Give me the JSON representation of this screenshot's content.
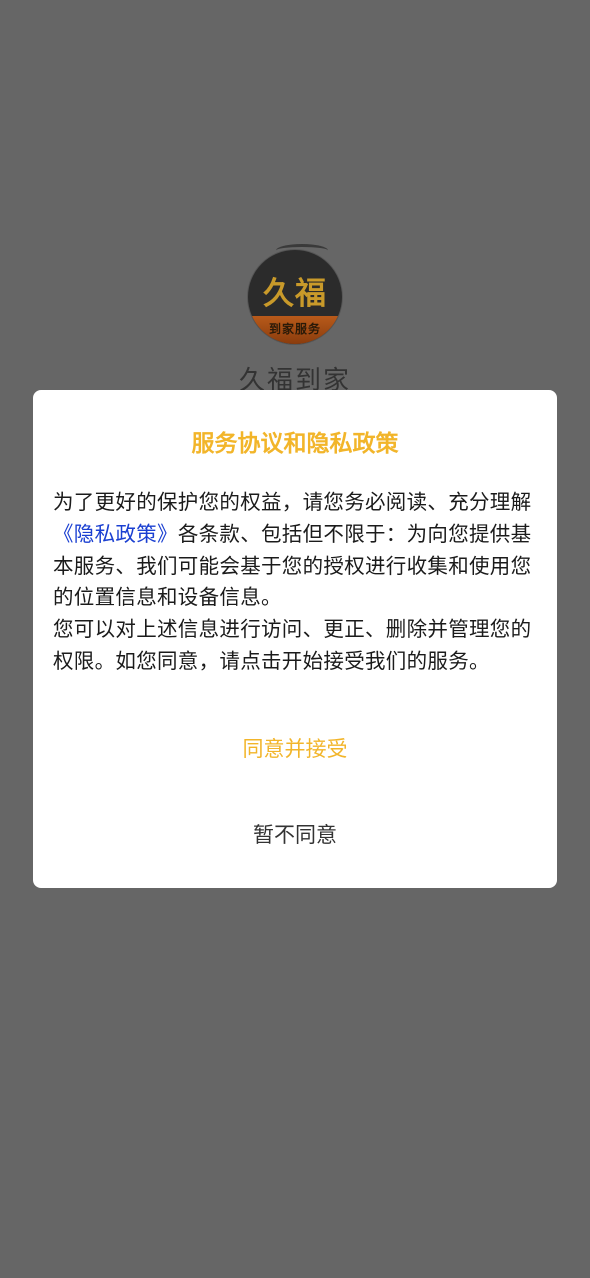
{
  "splash": {
    "logo_main": "久福",
    "logo_sub": "到家服务",
    "app_name": "久福到家"
  },
  "dialog": {
    "title": "服务协议和隐私政策",
    "para1_pre": "为了更好的保护您的权益，请您务必阅读、充分理解",
    "policy_link": "《隐私政策》",
    "para1_post": "各条款、包括但不限于：为向您提供基本服务、我们可能会基于您的授权进行收集和使用您的位置信息和设备信息。",
    "para2": "您可以对上述信息进行访问、更正、删除并管理您的权限。如您同意，请点击开始接受我们的服务。",
    "agree_label": "同意并接受",
    "decline_label": "暂不同意"
  },
  "colors": {
    "accent": "#f2b52a",
    "link": "#1a3fd1",
    "backdrop": "#666666"
  }
}
